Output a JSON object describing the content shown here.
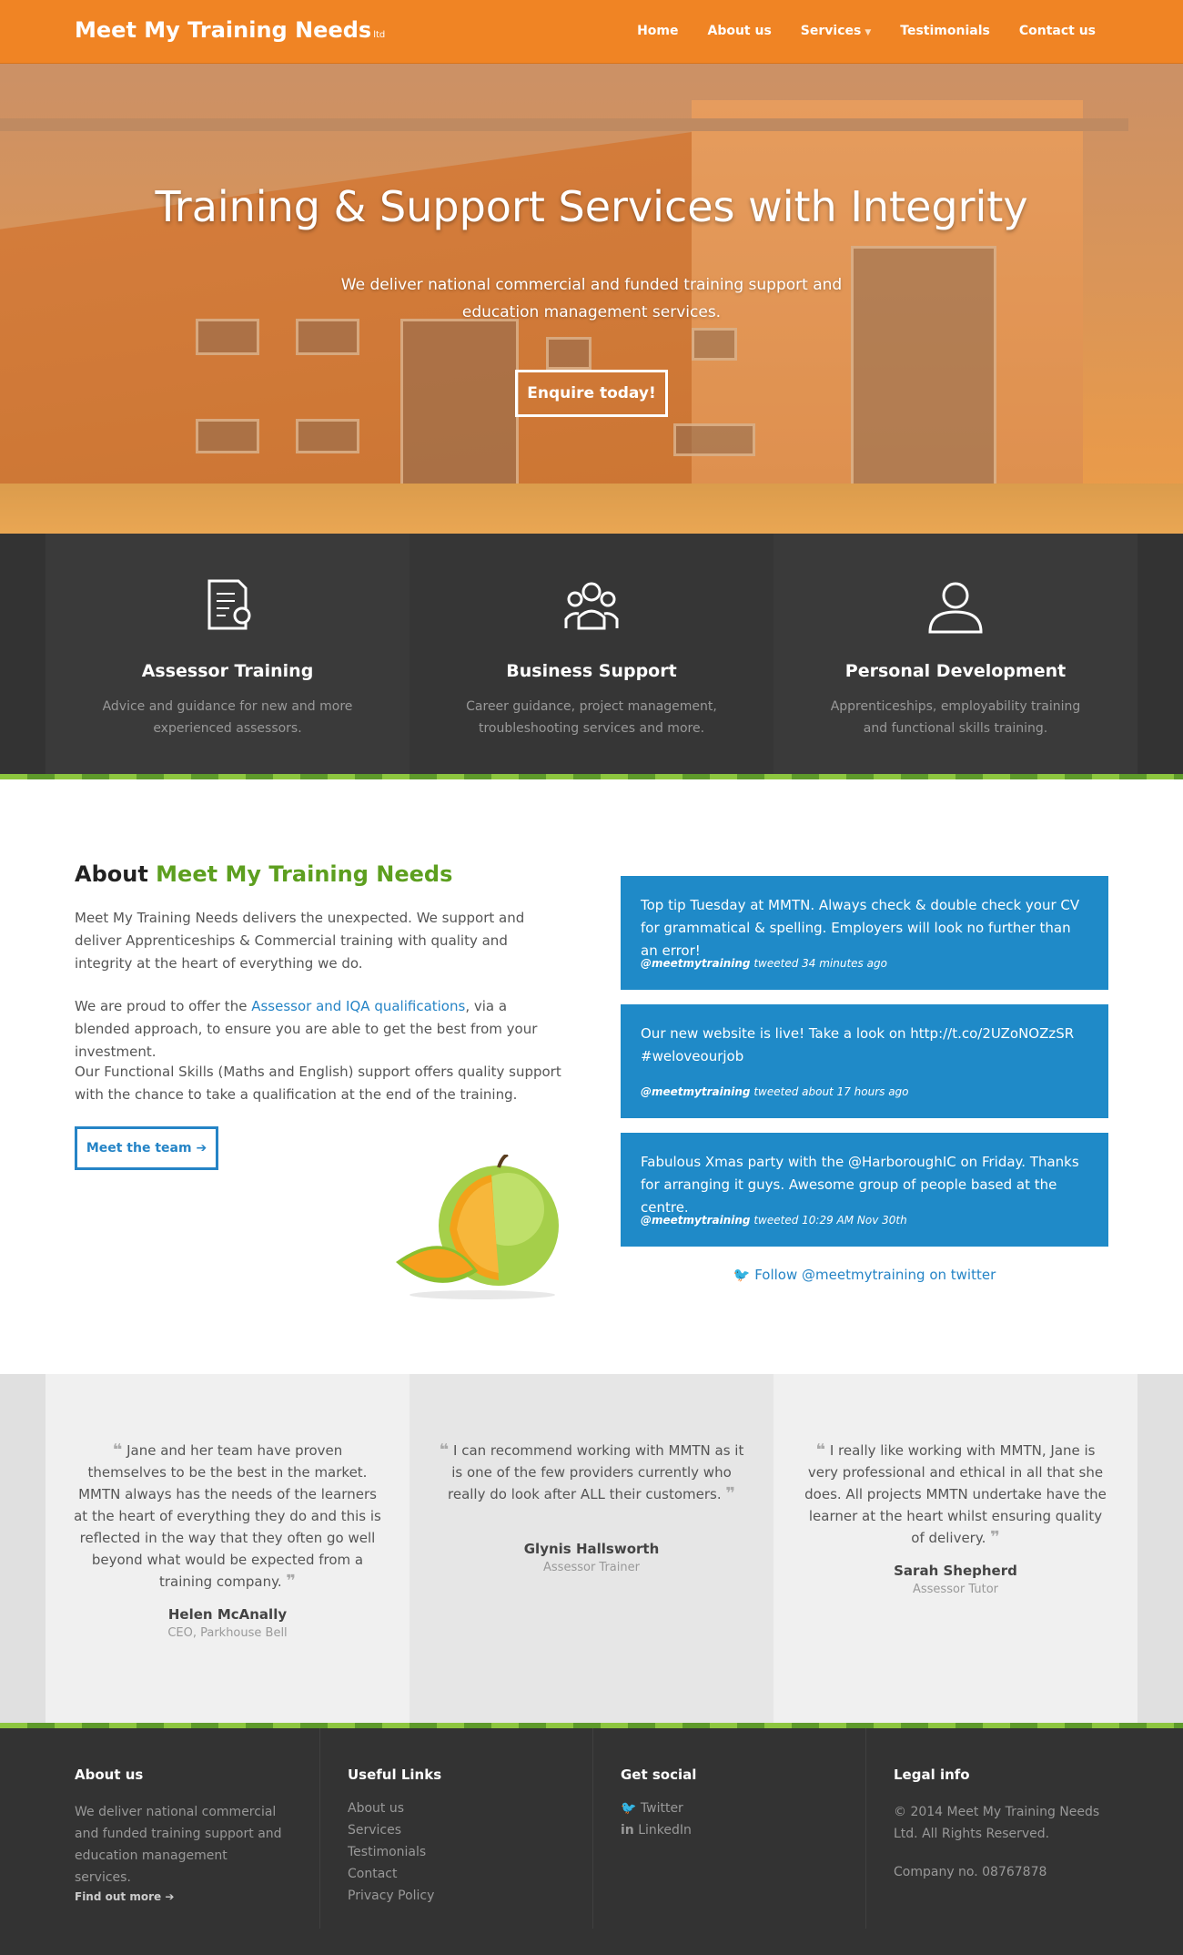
{
  "nav": {
    "brand": "Meet My Training Needs",
    "brand_suffix": "ltd",
    "items": [
      {
        "label": "Home"
      },
      {
        "label": "About us"
      },
      {
        "label": "Services",
        "has_dropdown": true
      },
      {
        "label": "Testimonials"
      },
      {
        "label": "Contact us"
      }
    ]
  },
  "hero": {
    "title": "Training & Support Services with Integrity",
    "subtitle": "We deliver national commercial and funded training support and education management services.",
    "cta": "Enquire today!"
  },
  "services": [
    {
      "title": "Assessor Training",
      "desc": "Advice and guidance for new and more experienced assessors.",
      "icon": "certificate-icon"
    },
    {
      "title": "Business Support",
      "desc": "Career guidance, project management, troubleshooting services and more.",
      "icon": "group-icon"
    },
    {
      "title": "Personal Development",
      "desc": "Apprenticeships, employability training and functional skills training.",
      "icon": "user-icon"
    }
  ],
  "about": {
    "title_prefix": "About",
    "title_highlight": "Meet My Training Needs",
    "p1": "Meet My Training Needs delivers the unexpected. We support and deliver Apprenticeships & Commercial training with quality and integrity at the heart of everything we do.",
    "p2_before": "We are proud to offer the ",
    "p2_link": "Assessor and IQA qualifications",
    "p2_after": ", via a blended approach, to ensure you are able to get the best from your investment.",
    "p3": "Our Functional Skills (Maths and English) support offers quality support with the chance to take a qualification at the end of the training.",
    "button": "Meet the team"
  },
  "tweets": [
    {
      "text": "Top tip Tuesday at MMTN. Always check & double check your CV for grammatical & spelling. Employers will look no further than an error!",
      "handle": "@meetmytraining",
      "time": "tweeted 34 minutes ago"
    },
    {
      "text": "Our new website is live! Take a look on http://t.co/2UZoNOZzSR #weloveourjob",
      "handle": "@meetmytraining",
      "time": "tweeted about 17 hours ago"
    },
    {
      "text": "Fabulous Xmas party with the @HarboroughIC on Friday. Thanks for arranging it guys. Awesome group of people based at the centre.",
      "handle": "@meetmytraining",
      "time": "tweeted 10:29 AM Nov 30th"
    }
  ],
  "follow": "Follow @meetmytraining on twitter",
  "testimonials": [
    {
      "quote": "Jane and her team have proven themselves to be the best in the market. MMTN always has the needs of the learners at the heart of everything they do and this is reflected in the way that they often go well beyond what would be expected from a training company.",
      "name": "Helen McAnally",
      "role": "CEO, Parkhouse Bell"
    },
    {
      "quote": "I can recommend working with MMTN as it is one of the few providers currently who really do look after ALL their customers.",
      "name": "Glynis Hallsworth",
      "role": "Assessor Trainer"
    },
    {
      "quote": "I really like working with MMTN, Jane is very professional and ethical in all that she does. All projects MMTN undertake have the learner at the heart whilst ensuring quality of delivery.",
      "name": "Sarah Shepherd",
      "role": "Assessor Tutor"
    }
  ],
  "footer": {
    "about": {
      "title": "About us",
      "text": "We deliver national commercial and funded training support and education management services.",
      "more": "Find out more"
    },
    "links": {
      "title": "Useful Links",
      "items": [
        "About us",
        "Services",
        "Testimonials",
        "Contact",
        "Privacy Policy"
      ]
    },
    "social": {
      "title": "Get social",
      "items": [
        {
          "label": "Twitter",
          "icon": "twitter-icon"
        },
        {
          "label": "LinkedIn",
          "icon": "linkedin-icon"
        }
      ]
    },
    "legal": {
      "title": "Legal info",
      "copyright": "© 2014 Meet My Training Needs Ltd. All Rights Reserved.",
      "company": "Company no. 08767878"
    }
  },
  "colors": {
    "orange": "#f08424",
    "green": "#5d9f1f",
    "blue": "#1f8ac8",
    "dark": "#333333"
  }
}
